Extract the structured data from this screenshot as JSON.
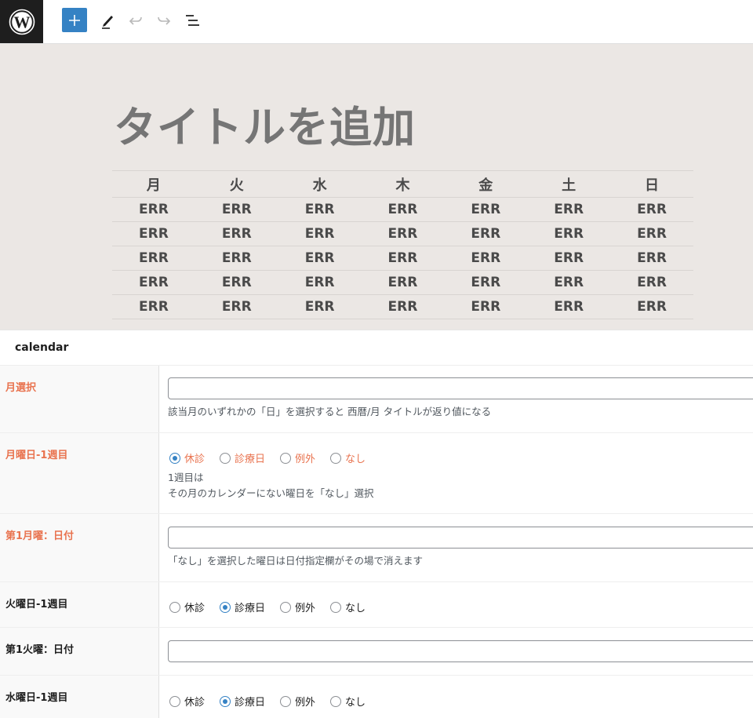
{
  "toolbar": {
    "logo_icon": "wordpress-logo",
    "add_icon": "plus-icon",
    "tools_icon": "pencil-icon",
    "undo_icon": "undo-icon",
    "redo_icon": "redo-icon",
    "outline_icon": "list-view-icon",
    "accent_color": "#3582c4"
  },
  "editor": {
    "title_placeholder": "タイトルを追加",
    "calendar": {
      "headers": [
        "月",
        "火",
        "水",
        "木",
        "金",
        "土",
        "日"
      ],
      "rows": [
        [
          "ERR",
          "ERR",
          "ERR",
          "ERR",
          "ERR",
          "ERR",
          "ERR"
        ],
        [
          "ERR",
          "ERR",
          "ERR",
          "ERR",
          "ERR",
          "ERR",
          "ERR"
        ],
        [
          "ERR",
          "ERR",
          "ERR",
          "ERR",
          "ERR",
          "ERR",
          "ERR"
        ],
        [
          "ERR",
          "ERR",
          "ERR",
          "ERR",
          "ERR",
          "ERR",
          "ERR"
        ],
        [
          "ERR",
          "ERR",
          "ERR",
          "ERR",
          "ERR",
          "ERR",
          "ERR"
        ]
      ]
    }
  },
  "metabox": {
    "title": "calendar",
    "fields": [
      {
        "label": "月選択",
        "label_color": "#e9734f",
        "type": "text",
        "value": "",
        "description": [
          "該当月のいずれかの「日」を選択すると 西暦/月 タイトルが返り値になる"
        ]
      },
      {
        "label": "月曜日-1週目",
        "label_color": "#e9734f",
        "type": "radio",
        "options": [
          "休診",
          "診療日",
          "例外",
          "なし"
        ],
        "selected": "休診",
        "description": [
          "1週目は",
          "その月のカレンダーにない曜日を「なし」選択"
        ]
      },
      {
        "label": "第1月曜：日付",
        "label_color": "#e9734f",
        "type": "text",
        "value": "",
        "description": [
          "「なし」を選択した曜日は日付指定欄がその場で消えます"
        ]
      },
      {
        "label": "火曜日-1週目",
        "label_color": "#1e1e1e",
        "type": "radio",
        "options": [
          "休診",
          "診療日",
          "例外",
          "なし"
        ],
        "selected": "診療日",
        "description": []
      },
      {
        "label": "第1火曜：日付",
        "label_color": "#1e1e1e",
        "type": "text",
        "value": "",
        "description": []
      },
      {
        "label": "水曜日-1週目",
        "label_color": "#1e1e1e",
        "type": "radio",
        "options": [
          "休診",
          "診療日",
          "例外",
          "なし"
        ],
        "selected": "診療日",
        "description": []
      }
    ]
  }
}
